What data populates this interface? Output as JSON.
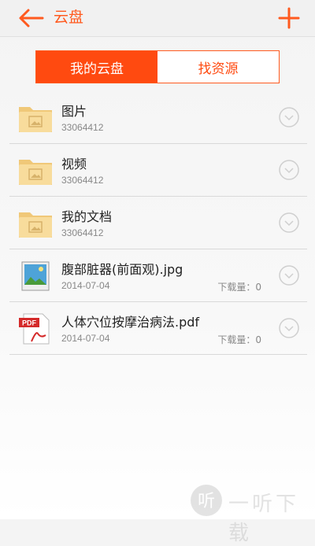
{
  "header": {
    "title": "云盘",
    "back_icon": "arrow-left-icon",
    "add_icon": "plus-icon"
  },
  "tabs": [
    {
      "label": "我的云盘",
      "active": true
    },
    {
      "label": "找资源",
      "active": false
    }
  ],
  "files": [
    {
      "name": "图片",
      "meta": "33064412",
      "type": "folder"
    },
    {
      "name": "视频",
      "meta": "33064412",
      "type": "folder"
    },
    {
      "name": "我的文档",
      "meta": "33064412",
      "type": "folder"
    },
    {
      "name": "腹部脏器(前面观).jpg",
      "meta": "2014-07-04",
      "type": "image",
      "downloads": "下载量：0"
    },
    {
      "name": "人体穴位按摩治病法.pdf",
      "meta": "2014-07-04",
      "type": "pdf",
      "downloads": "下载量：0",
      "badge": "PDF"
    }
  ],
  "watermark": {
    "text": "一听下载",
    "logo": "听"
  },
  "colors": {
    "accent": "#ff5a1f",
    "tab_active_bg": "#ff4a10"
  }
}
